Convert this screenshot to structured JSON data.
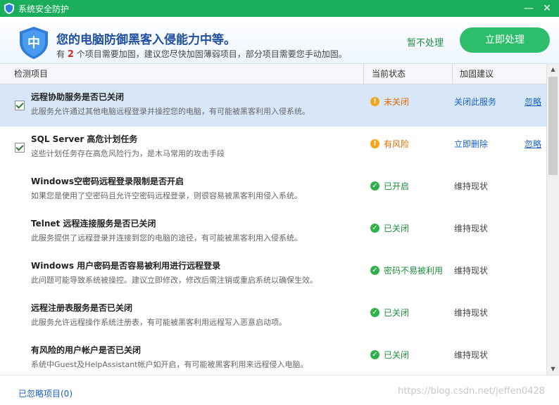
{
  "window": {
    "title": "系统安全防护",
    "minimize": "—",
    "close": "✕"
  },
  "header": {
    "shield_char": "中",
    "headline": "您的电脑防御黑客入侵能力中等。",
    "sub_prefix": "有",
    "sub_count": "2",
    "sub_suffix": "个项目需要加固，建议您尽快加固薄弱项目，部分项目需要您手动加固。",
    "ignore_label": "暂不处理",
    "process_label": "立即处理"
  },
  "columns": {
    "item": "检测项目",
    "status": "当前状态",
    "advice": "加固建议"
  },
  "rows": [
    {
      "checked": true,
      "title": "远程协助服务是否已关闭",
      "desc": "此服务允许通过其他电脑远程登录并操控您的电脑，有可能被黑客利用入侵系统。",
      "status_type": "warn",
      "status": "未关闭",
      "advice": "关闭此服务",
      "advice_link": true,
      "ignore": "忽略"
    },
    {
      "checked": true,
      "title": "SQL Server 高危计划任务",
      "desc": "这些计划任务存在高危风险行为，是木马常用的攻击手段",
      "status_type": "warn",
      "status": "有风险",
      "advice": "立即删除",
      "advice_link": true,
      "ignore": "忽略"
    },
    {
      "checked": false,
      "title": "Windows空密码远程登录限制是否开启",
      "desc": "如果您是使用了空密码且允许空密码远程登录，则很容易被黑客利用侵入系统。",
      "status_type": "ok",
      "status": "已开启",
      "advice": "维持现状",
      "advice_link": false,
      "ignore": ""
    },
    {
      "checked": false,
      "title": "Telnet 远程连接服务是否已关闭",
      "desc": "此服务提供了远程登录并连接到您的电脑的途径，有可能被黑客利用入侵系统。",
      "status_type": "ok",
      "status": "已关闭",
      "advice": "维持现状",
      "advice_link": false,
      "ignore": ""
    },
    {
      "checked": false,
      "title": "Windows 用户密码是否容易被利用进行远程登录",
      "desc": "此问题可能导致系统被操控。建议立即修改，修改后需注销或重启系统以确保生效。",
      "status_type": "ok",
      "status": "密码不易被利用",
      "advice": "维持现状",
      "advice_link": false,
      "ignore": ""
    },
    {
      "checked": false,
      "title": "远程注册表服务是否已关闭",
      "desc": "此服务允许远程操作系统注册表，有可能被黑客利用远程写入恶意启动项。",
      "status_type": "ok",
      "status": "已关闭",
      "advice": "维持现状",
      "advice_link": false,
      "ignore": ""
    },
    {
      "checked": false,
      "title": "有风险的用户帐户是否已关闭",
      "desc": "系统中Guest及HelpAssistant帐户如开启，有可能被黑客利用来远程侵入电脑。",
      "status_type": "ok",
      "status": "已关闭",
      "advice": "维持现状",
      "advice_link": false,
      "ignore": ""
    }
  ],
  "footer": {
    "ignored_label": "已忽略项目(0)",
    "watermark": "https://blog.csdn.net/jeffen0428"
  },
  "colors": {
    "titlebar": "#1aad5b",
    "primary_button": "#2ebd6b",
    "headline": "#1f4fa0",
    "warn": "#e06a00",
    "ok": "#1e8e3e",
    "link": "#1760c7"
  }
}
